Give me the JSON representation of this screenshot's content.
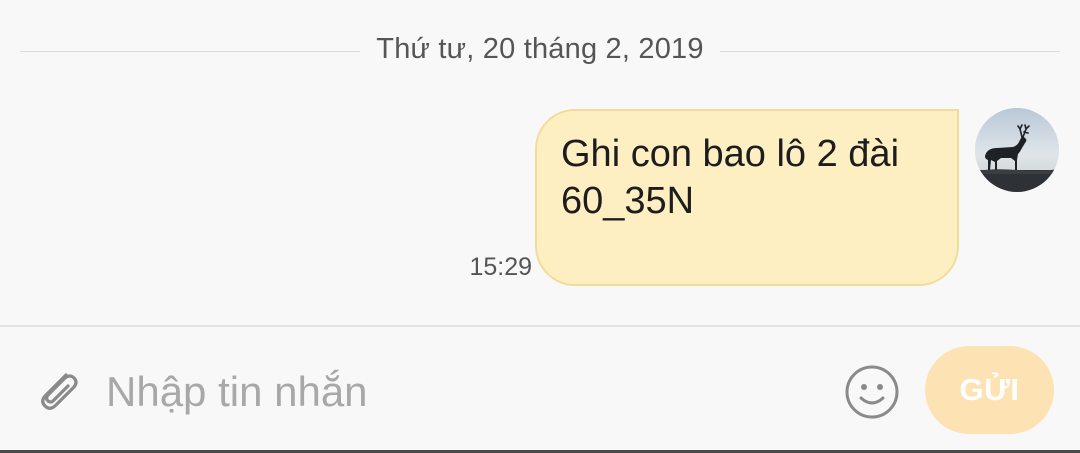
{
  "conversation": {
    "date_separator": "Thứ tư, 20 tháng 2, 2019",
    "messages": [
      {
        "direction": "outgoing",
        "text_lines": [
          "Ghi con bao lô 2 đài",
          "60_35N"
        ],
        "time": "15:29",
        "avatar_icon": "deer-silhouette-avatar"
      }
    ]
  },
  "composer": {
    "placeholder": "Nhập tin nhắn",
    "value": "",
    "attach_icon": "paperclip-icon",
    "emoji_icon": "smiley-icon",
    "send_label": "GỬI"
  },
  "colors": {
    "background": "#f8f8f8",
    "bubble_fill": "#fdefc2",
    "bubble_border": "#f2dc9a",
    "send_button": "#fde2b3",
    "icon_gray": "#8a8a8a",
    "placeholder": "#a8a8a8"
  }
}
